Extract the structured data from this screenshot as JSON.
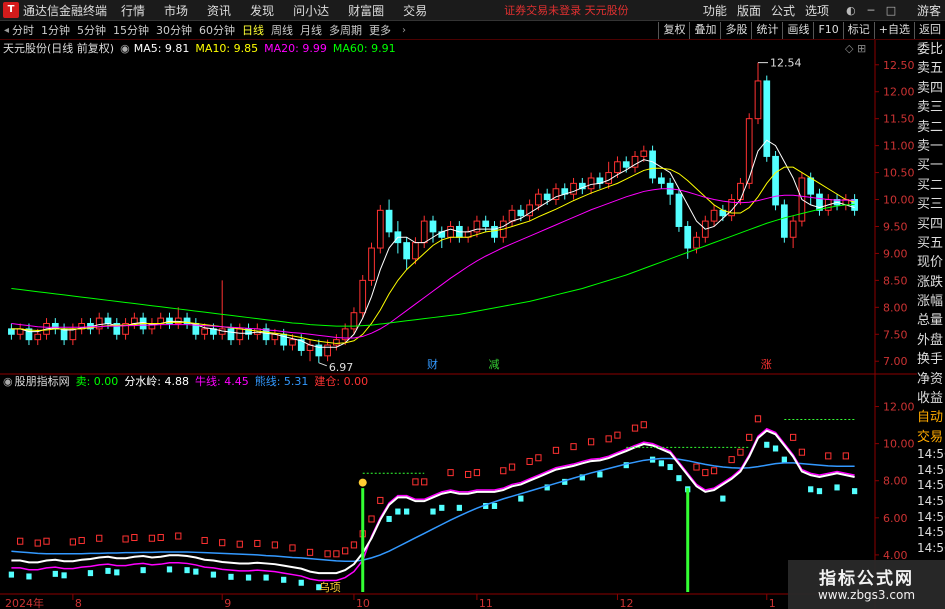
{
  "menubar": {
    "logo_text": "T",
    "app_title": "通达信金融终端",
    "items": [
      "行情",
      "市场",
      "资讯",
      "发现",
      "问小达",
      "财富圈",
      "交易"
    ],
    "status": "证券交易未登录  天元股份",
    "right_items": [
      "功能",
      "版面",
      "公式",
      "选项"
    ],
    "user": "游客"
  },
  "toolbar": {
    "periods": [
      "分时",
      "1分钟",
      "5分钟",
      "15分钟",
      "30分钟",
      "60分钟",
      "日线",
      "周线",
      "月线",
      "多周期",
      "更多"
    ],
    "active_period": "日线",
    "buttons": [
      "复权",
      "叠加",
      "多股",
      "统计",
      "画线",
      "F10",
      "标记",
      "+自选",
      "返回"
    ]
  },
  "main_panel": {
    "stock_title": "天元股份(日线 前复权)",
    "ma_labels": [
      {
        "text": "MA5: 9.81",
        "color": "#ffffff"
      },
      {
        "text": "MA10: 9.85",
        "color": "#ffff00"
      },
      {
        "text": "MA20: 9.99",
        "color": "#ff00ff"
      },
      {
        "text": "MA60: 9.91",
        "color": "#00ff00"
      }
    ],
    "high_label": "12.54",
    "low_label": "6.97",
    "event_markers": [
      {
        "text": "财",
        "color": "#3399ff"
      },
      {
        "text": "减",
        "color": "#33cc33"
      },
      {
        "text": "涨",
        "color": "#ff3333"
      }
    ],
    "y_ticks": [
      "12.50",
      "12.00",
      "11.50",
      "11.00",
      "10.50",
      "10.00",
      "9.50",
      "9.00",
      "8.50",
      "8.00",
      "7.50",
      "7.00"
    ]
  },
  "indicator_panel": {
    "title": "股朋指标网",
    "labels": [
      {
        "text": "卖: 0.00",
        "color": "#00ff00"
      },
      {
        "text": "分水岭: 4.88",
        "color": "#ffffff"
      },
      {
        "text": "牛线: 4.45",
        "color": "#ff00ff"
      },
      {
        "text": "熊线: 5.31",
        "color": "#3399ff"
      },
      {
        "text": "建仓: 0.00",
        "color": "#ff3333"
      }
    ],
    "y_ticks": [
      "12.00",
      "10.00",
      "8.00",
      "6.00",
      "4.00"
    ],
    "marker_text": "乌项"
  },
  "x_axis": {
    "labels": [
      "2024年",
      "8",
      "9",
      "10",
      "11",
      "12",
      "1"
    ]
  },
  "sidebar": {
    "items": [
      "委比",
      "卖五",
      "卖四",
      "卖三",
      "卖二",
      "卖一",
      "买一",
      "买二",
      "买三",
      "买四",
      "买五",
      "现价",
      "涨跌",
      "涨幅",
      "总量",
      "外盘",
      "换手",
      "净资",
      "收益",
      "自动",
      "交易"
    ],
    "times": [
      "14:56",
      "14:56",
      "14:56",
      "14:56",
      "14:56",
      "14:56",
      "14:56"
    ]
  },
  "watermark": {
    "title": "指标公式网",
    "url": "www.zbgs3.com"
  },
  "chart_data": {
    "type": "candlestick",
    "description_units": "price in CNY",
    "x_labels": [
      "2024年",
      "8",
      "9",
      "10",
      "11",
      "12",
      "1"
    ],
    "ylim": [
      6.8,
      12.7
    ],
    "candles": [
      [
        7.6,
        7.5,
        7.7,
        7.4
      ],
      [
        7.5,
        7.6,
        7.7,
        7.4
      ],
      [
        7.6,
        7.4,
        7.7,
        7.3
      ],
      [
        7.4,
        7.5,
        7.6,
        7.3
      ],
      [
        7.5,
        7.7,
        7.8,
        7.4
      ],
      [
        7.7,
        7.6,
        7.8,
        7.5
      ],
      [
        7.6,
        7.4,
        7.7,
        7.3
      ],
      [
        7.4,
        7.6,
        7.7,
        7.3
      ],
      [
        7.6,
        7.7,
        7.8,
        7.5
      ],
      [
        7.7,
        7.6,
        7.8,
        7.5
      ],
      [
        7.6,
        7.8,
        7.9,
        7.5
      ],
      [
        7.8,
        7.7,
        7.9,
        7.6
      ],
      [
        7.7,
        7.5,
        7.8,
        7.4
      ],
      [
        7.5,
        7.7,
        7.8,
        7.4
      ],
      [
        7.7,
        7.8,
        7.9,
        7.6
      ],
      [
        7.8,
        7.6,
        7.9,
        7.5
      ],
      [
        7.6,
        7.7,
        7.8,
        7.5
      ],
      [
        7.7,
        7.8,
        7.9,
        7.6
      ],
      [
        7.8,
        7.7,
        7.9,
        7.6
      ],
      [
        7.7,
        7.8,
        8.0,
        7.6
      ],
      [
        7.8,
        7.7,
        7.9,
        7.6
      ],
      [
        7.7,
        7.5,
        7.8,
        7.4
      ],
      [
        7.5,
        7.6,
        7.7,
        7.4
      ],
      [
        7.6,
        7.5,
        7.7,
        7.4
      ],
      [
        7.5,
        7.6,
        8.5,
        7.4
      ],
      [
        7.6,
        7.4,
        7.7,
        7.3
      ],
      [
        7.4,
        7.6,
        7.7,
        7.3
      ],
      [
        7.6,
        7.5,
        7.7,
        7.4
      ],
      [
        7.5,
        7.6,
        7.7,
        7.4
      ],
      [
        7.6,
        7.4,
        7.7,
        7.3
      ],
      [
        7.4,
        7.5,
        7.6,
        7.3
      ],
      [
        7.5,
        7.3,
        7.6,
        7.2
      ],
      [
        7.3,
        7.4,
        7.5,
        7.2
      ],
      [
        7.4,
        7.2,
        7.5,
        7.1
      ],
      [
        7.2,
        7.3,
        7.4,
        7.0
      ],
      [
        7.3,
        7.1,
        7.4,
        6.97
      ],
      [
        7.1,
        7.3,
        7.4,
        7.0
      ],
      [
        7.3,
        7.4,
        7.5,
        7.2
      ],
      [
        7.4,
        7.6,
        7.7,
        7.3
      ],
      [
        7.6,
        7.9,
        8.0,
        7.5
      ],
      [
        7.9,
        8.5,
        8.6,
        7.8
      ],
      [
        8.5,
        9.1,
        9.2,
        8.4
      ],
      [
        9.1,
        9.8,
        9.9,
        9.0
      ],
      [
        9.8,
        9.4,
        10.0,
        9.3
      ],
      [
        9.4,
        9.2,
        9.6,
        9.0
      ],
      [
        9.2,
        8.9,
        9.3,
        8.7
      ],
      [
        8.9,
        9.2,
        9.3,
        8.8
      ],
      [
        9.2,
        9.6,
        9.7,
        9.1
      ],
      [
        9.6,
        9.4,
        9.7,
        9.2
      ],
      [
        9.4,
        9.3,
        9.5,
        9.1
      ],
      [
        9.3,
        9.5,
        9.6,
        9.2
      ],
      [
        9.5,
        9.3,
        9.6,
        9.2
      ],
      [
        9.3,
        9.4,
        9.5,
        9.2
      ],
      [
        9.4,
        9.6,
        9.7,
        9.3
      ],
      [
        9.6,
        9.5,
        9.7,
        9.4
      ],
      [
        9.5,
        9.3,
        9.6,
        9.2
      ],
      [
        9.3,
        9.6,
        9.7,
        9.2
      ],
      [
        9.6,
        9.8,
        9.9,
        9.5
      ],
      [
        9.8,
        9.7,
        9.9,
        9.6
      ],
      [
        9.7,
        9.9,
        10.0,
        9.6
      ],
      [
        9.9,
        10.1,
        10.2,
        9.8
      ],
      [
        10.1,
        10.0,
        10.2,
        9.9
      ],
      [
        10.0,
        10.2,
        10.3,
        9.9
      ],
      [
        10.2,
        10.1,
        10.3,
        10.0
      ],
      [
        10.1,
        10.3,
        10.4,
        10.0
      ],
      [
        10.3,
        10.2,
        10.4,
        10.1
      ],
      [
        10.2,
        10.4,
        10.5,
        10.1
      ],
      [
        10.4,
        10.3,
        10.5,
        10.2
      ],
      [
        10.3,
        10.5,
        10.7,
        10.2
      ],
      [
        10.5,
        10.7,
        10.8,
        10.4
      ],
      [
        10.7,
        10.6,
        10.8,
        10.5
      ],
      [
        10.6,
        10.8,
        10.9,
        10.5
      ],
      [
        10.8,
        10.9,
        11.0,
        10.7
      ],
      [
        10.9,
        10.4,
        11.0,
        10.3
      ],
      [
        10.4,
        10.3,
        10.5,
        10.2
      ],
      [
        10.3,
        10.1,
        10.4,
        9.9
      ],
      [
        10.1,
        9.5,
        10.2,
        9.4
      ],
      [
        9.5,
        9.1,
        9.6,
        8.9
      ],
      [
        9.1,
        9.3,
        9.4,
        9.0
      ],
      [
        9.3,
        9.6,
        9.7,
        9.2
      ],
      [
        9.6,
        9.8,
        9.9,
        9.5
      ],
      [
        9.8,
        9.7,
        9.9,
        9.6
      ],
      [
        9.7,
        10.0,
        10.1,
        9.6
      ],
      [
        10.0,
        10.3,
        10.4,
        9.9
      ],
      [
        10.3,
        11.5,
        11.6,
        10.2
      ],
      [
        11.5,
        12.2,
        12.54,
        11.4
      ],
      [
        12.2,
        10.8,
        12.3,
        10.7
      ],
      [
        10.8,
        9.9,
        10.9,
        9.8
      ],
      [
        9.9,
        9.3,
        10.0,
        9.2
      ],
      [
        9.3,
        9.6,
        9.7,
        9.1
      ],
      [
        9.6,
        10.4,
        10.5,
        9.5
      ],
      [
        10.4,
        10.1,
        10.5,
        9.9
      ],
      [
        10.1,
        9.8,
        10.2,
        9.7
      ],
      [
        9.8,
        10.0,
        10.1,
        9.7
      ],
      [
        10.0,
        9.9,
        10.1,
        9.8
      ],
      [
        9.9,
        10.0,
        10.1,
        9.8
      ],
      [
        10.0,
        9.8,
        10.1,
        9.7
      ]
    ],
    "ma_series": [
      {
        "name": "MA5",
        "color": "#ffffff",
        "values": [
          7.6,
          7.6,
          7.55,
          7.55,
          7.6,
          7.62,
          7.58,
          7.58,
          7.62,
          7.64,
          7.68,
          7.7,
          7.66,
          7.66,
          7.7,
          7.72,
          7.68,
          7.7,
          7.74,
          7.74,
          7.72,
          7.68,
          7.62,
          7.6,
          7.56,
          7.54,
          7.52,
          7.52,
          7.54,
          7.52,
          7.5,
          7.46,
          7.42,
          7.38,
          7.3,
          7.26,
          7.26,
          7.26,
          7.34,
          7.5,
          7.8,
          8.2,
          8.7,
          9.1,
          9.3,
          9.3,
          9.2,
          9.2,
          9.3,
          9.4,
          9.45,
          9.4,
          9.4,
          9.45,
          9.45,
          9.45,
          9.5,
          9.6,
          9.65,
          9.75,
          9.85,
          9.95,
          10.05,
          10.1,
          10.15,
          10.22,
          10.28,
          10.3,
          10.36,
          10.46,
          10.55,
          10.65,
          10.74,
          10.7,
          10.6,
          10.5,
          10.2,
          9.9,
          9.6,
          9.45,
          9.5,
          9.65,
          9.8,
          10.0,
          10.4,
          10.9,
          11.1,
          11.0,
          10.7,
          10.4,
          10.0,
          9.9,
          9.85,
          9.9,
          9.95,
          9.9,
          9.85
        ]
      },
      {
        "name": "MA10",
        "color": "#ffff00",
        "values": [
          7.6,
          7.6,
          7.58,
          7.57,
          7.58,
          7.6,
          7.6,
          7.6,
          7.6,
          7.62,
          7.64,
          7.66,
          7.67,
          7.67,
          7.68,
          7.7,
          7.7,
          7.7,
          7.72,
          7.72,
          7.72,
          7.7,
          7.68,
          7.66,
          7.64,
          7.62,
          7.6,
          7.58,
          7.56,
          7.54,
          7.52,
          7.5,
          7.47,
          7.44,
          7.4,
          7.37,
          7.35,
          7.33,
          7.34,
          7.38,
          7.5,
          7.7,
          7.95,
          8.25,
          8.5,
          8.7,
          8.85,
          9.0,
          9.15,
          9.25,
          9.3,
          9.3,
          9.3,
          9.35,
          9.4,
          9.42,
          9.45,
          9.5,
          9.55,
          9.6,
          9.68,
          9.75,
          9.82,
          9.9,
          9.98,
          10.05,
          10.12,
          10.18,
          10.24,
          10.3,
          10.38,
          10.46,
          10.54,
          10.58,
          10.58,
          10.56,
          10.48,
          10.35,
          10.2,
          10.05,
          9.9,
          9.8,
          9.75,
          9.75,
          9.85,
          10.05,
          10.3,
          10.5,
          10.6,
          10.6,
          10.5,
          10.4,
          10.3,
          10.2,
          10.1,
          10.0,
          9.95
        ]
      },
      {
        "name": "MA20",
        "color": "#ff00ff",
        "values": [
          7.7,
          7.68,
          7.66,
          7.64,
          7.63,
          7.63,
          7.63,
          7.63,
          7.63,
          7.64,
          7.64,
          7.65,
          7.65,
          7.66,
          7.66,
          7.67,
          7.67,
          7.68,
          7.68,
          7.68,
          7.68,
          7.67,
          7.66,
          7.65,
          7.64,
          7.63,
          7.62,
          7.61,
          7.6,
          7.58,
          7.57,
          7.55,
          7.53,
          7.52,
          7.5,
          7.48,
          7.46,
          7.44,
          7.43,
          7.43,
          7.46,
          7.52,
          7.6,
          7.7,
          7.82,
          7.94,
          8.06,
          8.18,
          8.3,
          8.42,
          8.54,
          8.65,
          8.76,
          8.86,
          8.95,
          9.03,
          9.11,
          9.18,
          9.25,
          9.32,
          9.39,
          9.46,
          9.53,
          9.6,
          9.67,
          9.74,
          9.81,
          9.87,
          9.93,
          9.99,
          10.05,
          10.1,
          10.15,
          10.18,
          10.2,
          10.2,
          10.18,
          10.14,
          10.09,
          10.04,
          10.0,
          9.97,
          9.95,
          9.94,
          9.95,
          9.98,
          10.02,
          10.06,
          10.08,
          10.08,
          10.06,
          10.04,
          10.02,
          10.0,
          9.99,
          9.99,
          9.99
        ]
      },
      {
        "name": "MA60",
        "color": "#00ff00",
        "values": [
          8.35,
          8.33,
          8.31,
          8.29,
          8.27,
          8.25,
          8.23,
          8.21,
          8.19,
          8.17,
          8.15,
          8.13,
          8.11,
          8.09,
          8.07,
          8.05,
          8.03,
          8.01,
          7.99,
          7.97,
          7.95,
          7.93,
          7.91,
          7.89,
          7.87,
          7.85,
          7.83,
          7.81,
          7.79,
          7.77,
          7.75,
          7.73,
          7.71,
          7.7,
          7.68,
          7.67,
          7.66,
          7.65,
          7.65,
          7.65,
          7.66,
          7.67,
          7.69,
          7.71,
          7.73,
          7.75,
          7.77,
          7.79,
          7.81,
          7.83,
          7.85,
          7.87,
          7.9,
          7.93,
          7.96,
          7.99,
          8.02,
          8.05,
          8.08,
          8.11,
          8.15,
          8.19,
          8.23,
          8.27,
          8.31,
          8.35,
          8.4,
          8.45,
          8.5,
          8.55,
          8.6,
          8.66,
          8.72,
          8.78,
          8.84,
          8.9,
          8.96,
          9.02,
          9.08,
          9.14,
          9.2,
          9.26,
          9.32,
          9.38,
          9.44,
          9.5,
          9.56,
          9.61,
          9.66,
          9.7,
          9.74,
          9.78,
          9.82,
          9.85,
          9.88,
          9.9,
          9.91
        ]
      }
    ]
  }
}
